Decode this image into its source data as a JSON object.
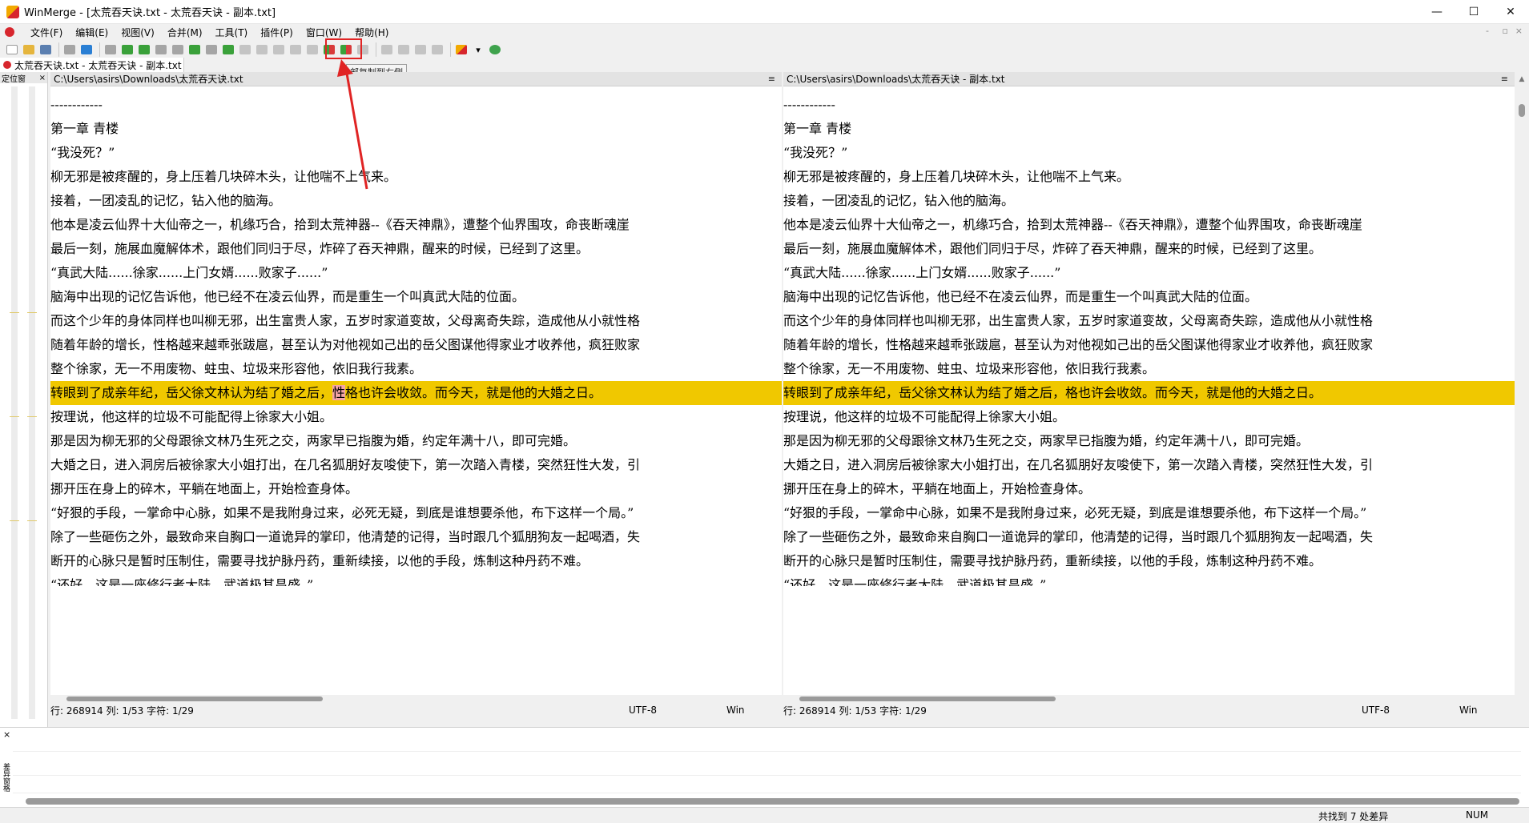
{
  "window": {
    "title": "WinMerge - [太荒吞天诀.txt - 太荒吞天诀 - 副本.txt]"
  },
  "window_controls": {
    "minimize": "—",
    "maximize": "☐",
    "close": "✕"
  },
  "menu": [
    "文件(F)",
    "编辑(E)",
    "视图(V)",
    "合并(M)",
    "工具(T)",
    "插件(P)",
    "窗口(W)",
    "帮助(H)"
  ],
  "mdi_controls": {
    "minimize": "-",
    "restore": "▫",
    "close": "×"
  },
  "tooltip": "部复制到右侧",
  "doc_tab": "太荒吞天诀.txt - 太荒吞天诀 - 副本.txt",
  "location_pane": {
    "title": "定位窗",
    "close": "×"
  },
  "left_pane": {
    "path": "C:\\Users\\asirs\\Downloads\\太荒吞天诀.txt",
    "status": {
      "pos": "行: 268914  列: 1/53  字符: 1/29",
      "encoding": "UTF-8",
      "eol": "Win"
    }
  },
  "right_pane": {
    "path": "C:\\Users\\asirs\\Downloads\\太荒吞天诀 - 副本.txt",
    "status": {
      "pos": "行: 268914  列: 1/53  字符: 1/29",
      "encoding": "UTF-8",
      "eol": "Win"
    }
  },
  "pane_menu_glyph": "≡",
  "lines": [
    "------------",
    "第一章  青楼",
    "    “我没死？”",
    "    柳无邪是被疼醒的，身上压着几块碎木头，让他喘不上气来。",
    "    接着，一团凌乱的记忆，钻入他的脑海。",
    "    他本是凌云仙界十大仙帝之一，机缘巧合，拾到太荒神器--《吞天神鼎》，遭整个仙界围攻，命丧断魂崖",
    "    最后一刻，施展血魔解体术，跟他们同归于尽，炸碎了吞天神鼎，醒来的时候，已经到了这里。",
    "    “真武大陆......徐家......上门女婿......败家子......”",
    "    脑海中出现的记忆告诉他，他已经不在凌云仙界，而是重生一个叫真武大陆的位面。",
    "    而这个少年的身体同样也叫柳无邪，出生富贵人家，五岁时家道变故，父母离奇失踪，造成他从小就性格",
    "    随着年龄的增长，性格越来越乖张跋扈，甚至认为对他视如己出的岳父图谋他得家业才收养他，疯狂败家",
    "    整个徐家，无一不用废物、蛀虫、垃圾来形容他，依旧我行我素。",
    "",
    "    按理说，他这样的垃圾不可能配得上徐家大小姐。",
    "    那是因为柳无邪的父母跟徐文林乃生死之交，两家早已指腹为婚，约定年满十八，即可完婚。",
    "    大婚之日，进入洞房后被徐家大小姐打出，在几名狐朋好友唆使下，第一次踏入青楼，突然狂性大发，引",
    "    挪开压在身上的碎木，平躺在地面上，开始检查身体。",
    "    “好狠的手段，一掌命中心脉，如果不是我附身过来，必死无疑，到底是谁想要杀他，布下这样一个局。”",
    "    除了一些砸伤之外，最致命来自胸口一道诡异的掌印，他清楚的记得，当时跟几个狐朋狗友一起喝酒，失",
    "    断开的心脉只是暂时压制住，需要寻找护脉丹药，重新续接，以他的手段，炼制这种丹药不难。",
    "    “还好，这是一座修行者大陆，武道极其昌盛。”"
  ],
  "diff_line": {
    "left_before": "    转眼到了成亲年纪，岳父徐文林认为结了婚之后，",
    "left_sel": "性",
    "left_after": "格也许会收敛。而今天，就是他的大婚之日。",
    "right": "    转眼到了成亲年纪，岳父徐文林认为结了婚之后，格也许会收敛。而今天，就是他的大婚之日。"
  },
  "diff_pane": {
    "close": "×",
    "label": "差异窗格"
  },
  "statusbar": {
    "diff_count": "共找到 7 处差异",
    "num": "NUM"
  }
}
